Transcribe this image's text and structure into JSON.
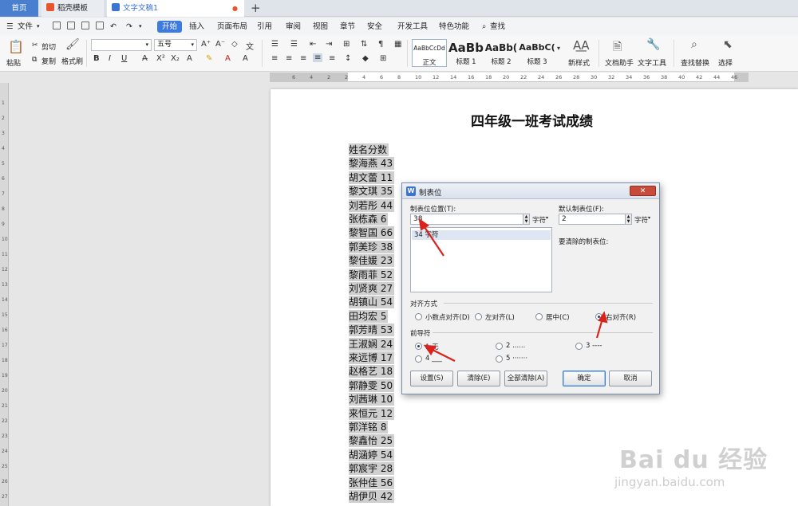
{
  "tabs": {
    "home": "首页",
    "template": "稻壳模板",
    "document": "文字文稿1",
    "add": "+"
  },
  "menubar": {
    "file": "文件",
    "items": [
      "开始",
      "插入",
      "页面布局",
      "引用",
      "审阅",
      "视图",
      "章节",
      "安全",
      "开发工具",
      "特色功能"
    ],
    "search": "查找"
  },
  "ribbon": {
    "paste": "粘贴",
    "cut": "剪切",
    "copy": "复制",
    "format_painter": "格式刷",
    "font_name": "",
    "font_size": "五号",
    "bold": "B",
    "italic": "I",
    "underline": "U",
    "styles": [
      {
        "preview": "AaBbCcDd",
        "name": "正文"
      },
      {
        "preview": "AaBb",
        "name": "标题 1"
      },
      {
        "preview": "AaBb(",
        "name": "标题 2"
      },
      {
        "preview": "AaBbC(",
        "name": "标题 3"
      }
    ],
    "new_style": "新样式",
    "doc_helper": "文档助手",
    "text_tools": "文字工具",
    "find_replace": "查找替换",
    "select": "选择"
  },
  "ruler": {
    "h_ticks": [
      "6",
      "4",
      "2",
      "2",
      "4",
      "6",
      "8",
      "10",
      "12",
      "14",
      "16",
      "18",
      "20",
      "22",
      "24",
      "26",
      "28",
      "30",
      "32",
      "34",
      "36",
      "38",
      "40",
      "42",
      "44",
      "46"
    ],
    "v_ticks": [
      "1",
      "2",
      "3",
      "4",
      "5",
      "6",
      "7",
      "8",
      "9",
      "10",
      "11",
      "12",
      "13",
      "14",
      "15",
      "16",
      "17",
      "18",
      "19",
      "20",
      "21",
      "22",
      "23",
      "24",
      "25",
      "26",
      "27"
    ]
  },
  "document": {
    "title": "四年级一班考试成绩",
    "lines": [
      "姓名分数",
      "黎海燕 43",
      "胡文蕾 11",
      "黎文琪 35",
      "刘若彤 44",
      "张栋森 6",
      "黎智国 66",
      "郭美珍 38",
      "黎佳媛 23",
      "黎雨菲 52",
      "刘贤爽 27",
      "胡镇山 54",
      "田均宏 5",
      "郭芳晴 53",
      "王淑娴 24",
      "来远博 17",
      "赵格艺 18",
      "郭静雯 50",
      "刘茜琳 10",
      "来恒元 12",
      "郭洋铭 8",
      "黎鑫怡 25",
      "胡涵婷 54",
      "郭宸宇 28",
      "张仲佳 56",
      "胡伊贝 42"
    ]
  },
  "dialog": {
    "title": "制表位",
    "close": "✕",
    "tab_position_label": "制表位位置(T):",
    "tab_position_value": "38",
    "unit": "字符",
    "list_items": [
      "34 字符"
    ],
    "default_tab_label": "默认制表位(F):",
    "default_tab_value": "2",
    "clear_label": "要清除的制表位:",
    "alignment_label": "对齐方式",
    "alignments": [
      "小数点对齐(D)",
      "左对齐(L)",
      "居中(C)",
      "右对齐(R)"
    ],
    "alignment_selected": "右对齐(R)",
    "leader_label": "前导符",
    "leaders": [
      "1 无",
      "2 ......",
      "3 ----",
      "4 ___",
      "5 ·······"
    ],
    "leader_selected": "1 无",
    "buttons": {
      "set": "设置(S)",
      "clear": "清除(E)",
      "clear_all": "全部清除(A)",
      "ok": "确定",
      "cancel": "取消"
    }
  },
  "watermark": {
    "main": "Bai du 经验",
    "sub": "jingyan.baidu.com"
  },
  "colors": {
    "accent": "#3d7be0",
    "annotation_arrow": "#d9231c",
    "close_button": "#c74b3b",
    "selection": "#cfcfcf"
  }
}
